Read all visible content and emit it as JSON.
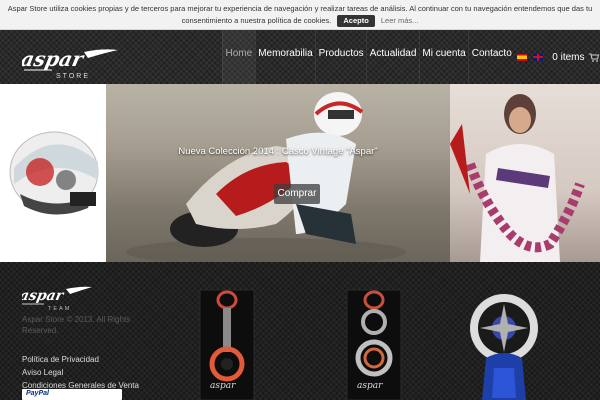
{
  "cookie_bar": {
    "line1": "Aspar Store utiliza cookies propias y de terceros para mejorar tu experiencia de navegación y realizar tareas de análisis. Al continuar con tu navegación entendemos que das tu",
    "line2": "consentimiento a nuestra política de cookies.",
    "accept_label": "Acepto",
    "more_label": "Leer más..."
  },
  "header": {
    "logo_alt": "Aspar Store",
    "nav": [
      {
        "label": "Home",
        "active": true
      },
      {
        "label": "Memorabilia"
      },
      {
        "label": "Productos"
      },
      {
        "label": "Actualidad"
      },
      {
        "label": "Mi cuenta"
      },
      {
        "label": "Contacto"
      }
    ],
    "languages": [
      "es",
      "en"
    ],
    "cart_label": "0 items",
    "cart_icon": "cart-icon"
  },
  "hero": {
    "caption": "Nueva Colección 2014 : Casco Vintage \"Aspar\"",
    "button_label": "Comprar"
  },
  "footer": {
    "logo_alt": "Aspar Team",
    "copyright": "Aspar Store © 2013. All Rights Reserved.",
    "links": [
      "Política de Privacidad",
      "Aviso Legal",
      "Condiciones Generales de Venta"
    ],
    "payment": "PayPal"
  },
  "colors": {
    "cookie_bg": "#f2f2f2",
    "header_bg": "#262626",
    "footer_bg": "#1e1e1e",
    "accent_red": "#c0392b"
  }
}
